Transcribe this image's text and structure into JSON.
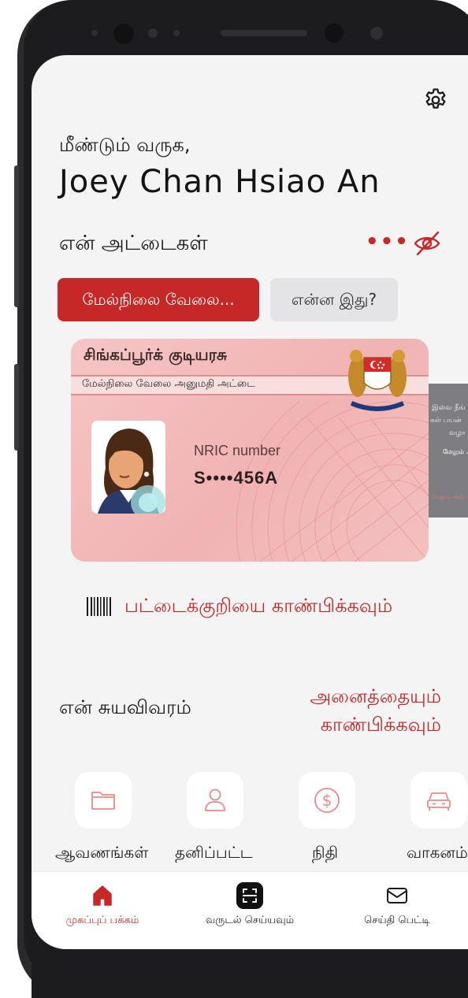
{
  "header": {
    "greeting": "மீண்டும் வருக,",
    "user_name": "Joey Chan Hsiao An"
  },
  "cards_section": {
    "heading": "என் அட்டைகள்",
    "more_label": "•••",
    "tabs": [
      {
        "label": "மேல்நிலை வேலை..."
      },
      {
        "label": "என்ன இது?"
      }
    ]
  },
  "id_card": {
    "title": "சிங்கப்பூர்க் குடியரசு",
    "subtitle": "மேல்நிலை வேலை அனுமதி அட்டை",
    "nric_label": "NRIC number",
    "nric_value": "S••••456A"
  },
  "side_panel": {
    "line1": "இவை நீங்",
    "line2": "கள் பயன்",
    "line3": "வழா",
    "line4": "மேலும் .",
    "line5": "மேலும் அறிய"
  },
  "barcode": {
    "label": "பட்டைக்குறியை காண்பிக்கவும்"
  },
  "profile_section": {
    "heading": "என் சுயவிவரம்",
    "show_all_line1": "அனைத்தையும்",
    "show_all_line2": "காண்பிக்கவும்",
    "tiles": [
      {
        "label": "ஆவணங்கள்",
        "icon": "folder-icon"
      },
      {
        "label": "தனிப்பட்ட",
        "icon": "person-icon"
      },
      {
        "label": "நிதி",
        "icon": "dollar-icon"
      },
      {
        "label": "வாகனம்",
        "icon": "car-icon"
      }
    ]
  },
  "bottom_nav": {
    "items": [
      {
        "label": "முகப்புப் பக்கம்",
        "icon": "home-icon",
        "active": true
      },
      {
        "label": "வருடல் செய்யவும்",
        "icon": "scan-icon",
        "active": false
      },
      {
        "label": "செய்தி பெட்டி",
        "icon": "mail-icon",
        "active": false
      }
    ]
  },
  "colors": {
    "accent": "#c62828",
    "background": "#f4f4f5",
    "card_pink": "#f4bcbc",
    "tab_inactive": "#e4e4e6"
  }
}
